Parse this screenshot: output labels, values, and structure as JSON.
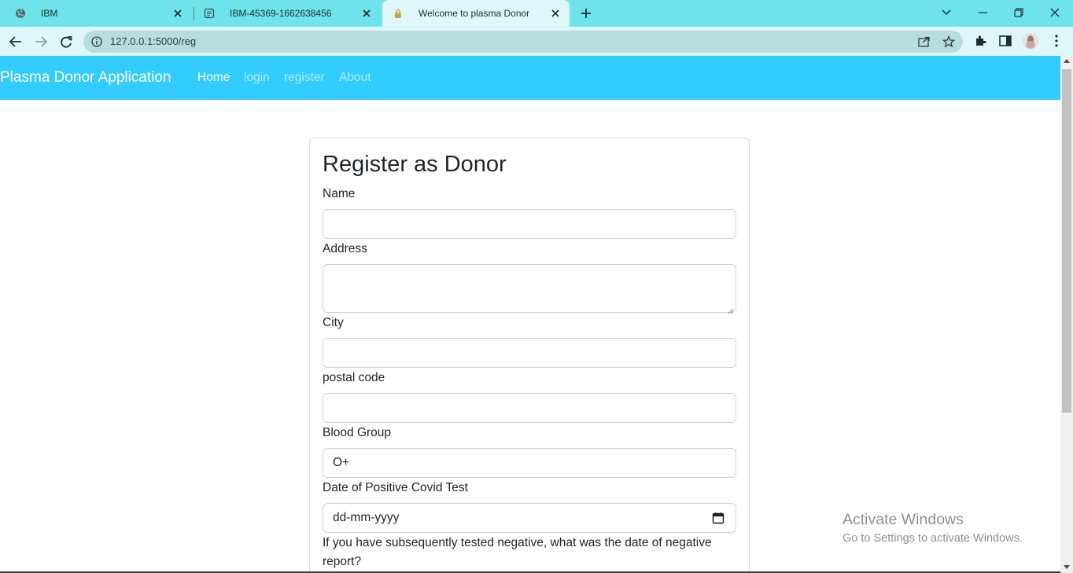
{
  "browser": {
    "tabs": [
      {
        "title": "IBM",
        "icon": "globe-icon",
        "active": false
      },
      {
        "title": "IBM-45369-1662638456",
        "icon": "document-icon",
        "active": false
      },
      {
        "title": "Welcome to plasma Donor",
        "icon": "lock-page-icon",
        "active": true
      }
    ],
    "url": "127.0.0.1:5000/reg",
    "colors": {
      "tabstrip": "#6fe3ec",
      "toolbar": "#e0f7f9",
      "omnibox": "#b9dcdf"
    }
  },
  "page": {
    "navbar": {
      "brand": "Plasma Donor Application",
      "links": [
        "Home",
        "login",
        "register",
        "About"
      ],
      "color": "#33ccfe"
    },
    "form": {
      "title": "Register as Donor",
      "name_label": "Name",
      "name_value": "",
      "address_label": "Address",
      "address_value": "",
      "city_label": "City",
      "city_value": "",
      "postal_label": "postal code",
      "postal_value": "",
      "blood_label": "Blood Group",
      "blood_value": "O+",
      "covid_date_label": "Date of Positive Covid Test",
      "covid_date_placeholder": "dd-mm-yyyy",
      "negative_label": "If you have subsequently tested negative, what was the date of negative report?"
    }
  },
  "watermark": {
    "title": "Activate Windows",
    "subtitle": "Go to Settings to activate Windows."
  }
}
